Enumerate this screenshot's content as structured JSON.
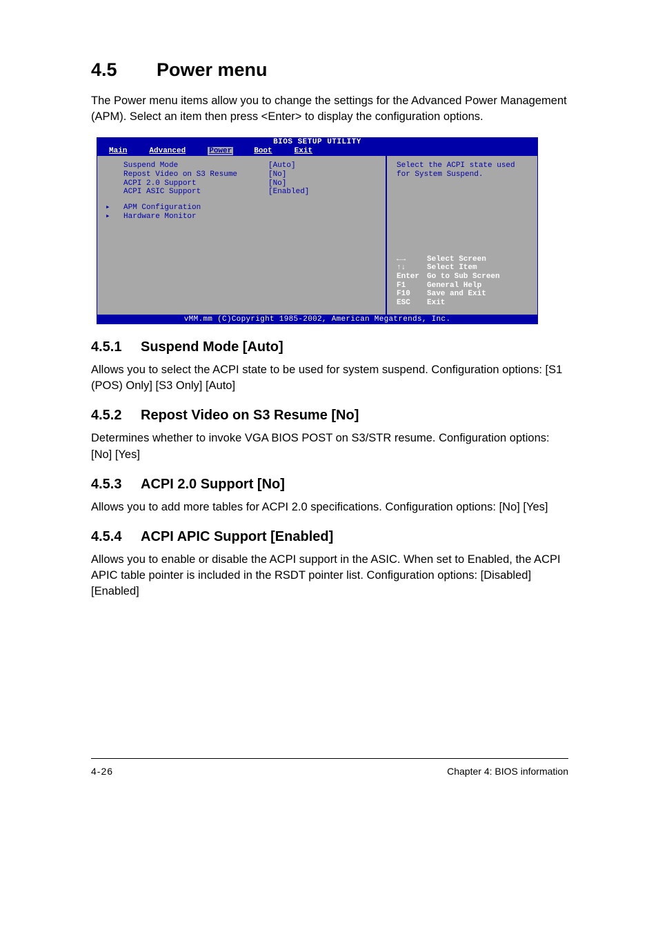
{
  "section": {
    "number": "4.5",
    "title": "Power menu"
  },
  "intro": "The Power menu items allow you to change the settings for the Advanced Power Management (APM). Select an item then press <Enter> to display the configuration options.",
  "bios": {
    "title": "BIOS SETUP UTILITY",
    "tabs": [
      "Main",
      "Advanced",
      "Power",
      "Boot",
      "Exit"
    ],
    "active_tab": "Power",
    "items": [
      {
        "label": "Suspend Mode",
        "value": "[Auto]"
      },
      {
        "label": "Repost Video on S3 Resume",
        "value": "[No]"
      },
      {
        "label": "ACPI 2.0 Support",
        "value": "[No]"
      },
      {
        "label": "ACPI ASIC Support",
        "value": "[Enabled]"
      }
    ],
    "submenus": [
      "APM Configuration",
      "Hardware Monitor"
    ],
    "help_text": "Select the ACPI state used for System Suspend.",
    "keys": [
      {
        "k": "←→",
        "d": "Select Screen"
      },
      {
        "k": "↑↓",
        "d": "Select Item"
      },
      {
        "k": "Enter",
        "d": "Go to Sub Screen"
      },
      {
        "k": "F1",
        "d": "General Help"
      },
      {
        "k": "F10",
        "d": "Save and Exit"
      },
      {
        "k": "ESC",
        "d": "Exit"
      }
    ],
    "footer": "vMM.mm (C)Copyright 1985-2002, American Megatrends, Inc."
  },
  "subs": [
    {
      "num": "4.5.1",
      "title": "Suspend Mode [Auto]",
      "body": "Allows you to select the ACPI state to be used for system suspend. Configuration options:  [S1 (POS) Only] [S3 Only] [Auto]"
    },
    {
      "num": "4.5.2",
      "title": "Repost Video on S3 Resume [No]",
      "body": "Determines whether to invoke VGA BIOS POST on S3/STR resume. Configuration options: [No] [Yes]"
    },
    {
      "num": "4.5.3",
      "title": "ACPI 2.0 Support [No]",
      "body": "Allows you to add more tables for ACPI 2.0 specifications. Configuration options: [No] [Yes]"
    },
    {
      "num": "4.5.4",
      "title": "ACPI APIC Support [Enabled]",
      "body": "Allows you to enable or disable the ACPI support in the ASIC. When set to Enabled, the ACPI APIC table pointer is included in the RSDT pointer list. Configuration options: [Disabled] [Enabled]"
    }
  ],
  "footer": {
    "page": "4-26",
    "chapter": "Chapter 4: BIOS information"
  }
}
